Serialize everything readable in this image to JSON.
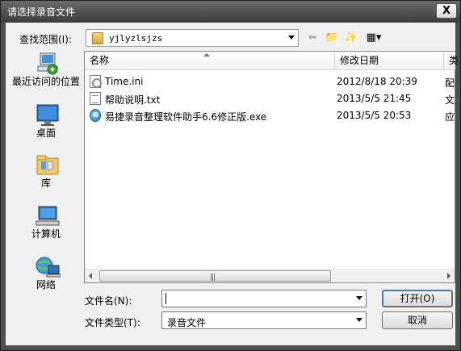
{
  "window": {
    "title": "请选择录音文件",
    "close_label": "X"
  },
  "lookin": {
    "label": "查找范围(I):",
    "value": "yjlyzlsjzs"
  },
  "toolbar": {
    "back": "⬅",
    "up_folder": "📁",
    "new_folder": "✨",
    "view_menu": "▦▾"
  },
  "places": [
    {
      "label": "最近访问的位置",
      "icon": "recent-places-icon"
    },
    {
      "label": "桌面",
      "icon": "desktop-icon"
    },
    {
      "label": "库",
      "icon": "libraries-icon"
    },
    {
      "label": "计算机",
      "icon": "computer-icon"
    },
    {
      "label": "网络",
      "icon": "network-icon"
    }
  ],
  "list": {
    "columns": [
      "名称",
      "修改日期",
      "类"
    ],
    "rows": [
      {
        "name": "Time.ini",
        "date": "2012/8/18 20:39",
        "type": "配",
        "icon": "ini-file-icon"
      },
      {
        "name": "帮助说明.txt",
        "date": "2013/5/5 21:45",
        "type": "文",
        "icon": "text-file-icon"
      },
      {
        "name": "易捷录音整理软件助手6.6修正版.exe",
        "date": "2013/5/5 20:53",
        "type": "应",
        "icon": "exe-file-icon"
      }
    ],
    "scroll_grip": "|||"
  },
  "filename": {
    "label": "文件名(N):",
    "value": ""
  },
  "filetype": {
    "label": "文件类型(T):",
    "value": "录音文件"
  },
  "buttons": {
    "open": "打开(O)",
    "cancel": "取消"
  }
}
